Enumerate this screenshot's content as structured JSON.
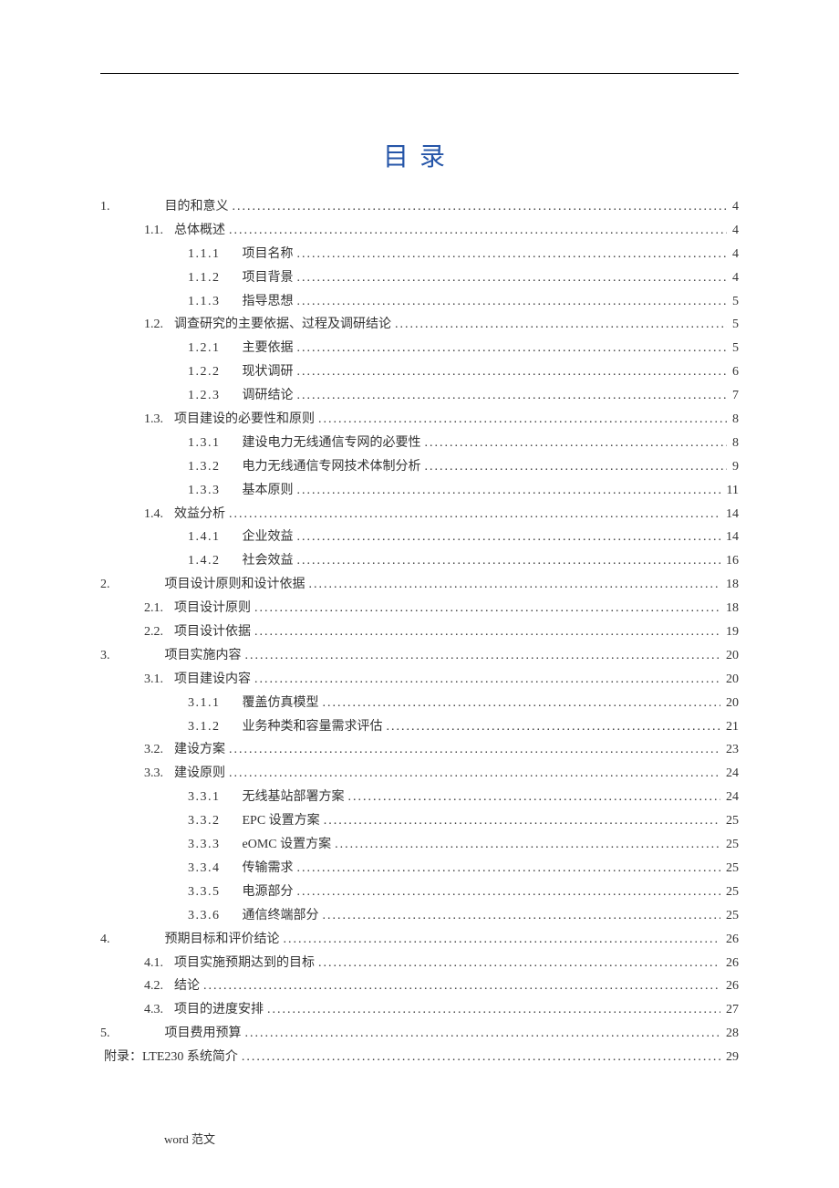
{
  "title": "目录",
  "footer": "word 范文",
  "toc": [
    {
      "level": 0,
      "num": "1.",
      "text": "目的和意义",
      "page": "4",
      "gap": 56
    },
    {
      "level": 1,
      "num": "1.1.",
      "text": "总体概述",
      "page": "4"
    },
    {
      "level": 2,
      "num": "1.1.1",
      "text": "项目名称",
      "page": "4"
    },
    {
      "level": 2,
      "num": "1.1.2",
      "text": "项目背景",
      "page": "4"
    },
    {
      "level": 2,
      "num": "1.1.3",
      "text": "指导思想",
      "page": "5"
    },
    {
      "level": 1,
      "num": "1.2.",
      "text": "调查研究的主要依据、过程及调研结论",
      "page": "5"
    },
    {
      "level": 2,
      "num": "1.2.1",
      "text": "主要依据",
      "page": "5"
    },
    {
      "level": 2,
      "num": "1.2.2",
      "text": "现状调研",
      "page": "6"
    },
    {
      "level": 2,
      "num": "1.2.3",
      "text": "调研结论",
      "page": "7"
    },
    {
      "level": 1,
      "num": "1.3.",
      "text": "项目建设的必要性和原则",
      "page": "8"
    },
    {
      "level": 2,
      "num": "1.3.1",
      "text": "建设电力无线通信专网的必要性",
      "page": "8"
    },
    {
      "level": 2,
      "num": "1.3.2",
      "text": "电力无线通信专网技术体制分析",
      "page": "9"
    },
    {
      "level": 2,
      "num": "1.3.3",
      "text": "基本原则",
      "page": "11"
    },
    {
      "level": 1,
      "num": "1.4.",
      "text": "效益分析",
      "page": "14"
    },
    {
      "level": 2,
      "num": "1.4.1",
      "text": "企业效益",
      "page": "14"
    },
    {
      "level": 2,
      "num": "1.4.2",
      "text": "社会效益",
      "page": "16"
    },
    {
      "level": 0,
      "num": "2.",
      "text": "项目设计原则和设计依据",
      "page": "18",
      "gap": 56
    },
    {
      "level": 1,
      "num": "2.1.",
      "text": "项目设计原则",
      "page": "18"
    },
    {
      "level": 1,
      "num": "2.2.",
      "text": "项目设计依据",
      "page": "19"
    },
    {
      "level": 0,
      "num": "3.",
      "text": "项目实施内容",
      "page": "20",
      "gap": 56
    },
    {
      "level": 1,
      "num": "3.1.",
      "text": "项目建设内容",
      "page": "20"
    },
    {
      "level": 2,
      "num": "3.1.1",
      "text": "覆盖仿真模型",
      "page": "20"
    },
    {
      "level": 2,
      "num": "3.1.2",
      "text": "业务种类和容量需求评估",
      "page": "21"
    },
    {
      "level": 1,
      "num": "3.2.",
      "text": "建设方案",
      "page": "23"
    },
    {
      "level": 1,
      "num": "3.3.",
      "text": "建设原则",
      "page": "24"
    },
    {
      "level": 2,
      "num": "3.3.1",
      "text": "无线基站部署方案",
      "page": "24"
    },
    {
      "level": 2,
      "num": "3.3.2",
      "text": "EPC 设置方案",
      "page": "25"
    },
    {
      "level": 2,
      "num": "3.3.3",
      "text": "eOMC 设置方案",
      "page": "25"
    },
    {
      "level": 2,
      "num": "3.3.4",
      "text": "传输需求",
      "page": "25"
    },
    {
      "level": 2,
      "num": "3.3.5",
      "text": "电源部分",
      "page": "25"
    },
    {
      "level": 2,
      "num": "3.3.6",
      "text": "通信终端部分",
      "page": "25"
    },
    {
      "level": 0,
      "num": "4.",
      "text": "预期目标和评价结论",
      "page": "26",
      "gap": 56
    },
    {
      "level": 1,
      "num": "4.1.",
      "text": "项目实施预期达到的目标",
      "page": "26"
    },
    {
      "level": 1,
      "num": "4.2.",
      "text": "结论",
      "page": "26"
    },
    {
      "level": 1,
      "num": "4.3.",
      "text": "项目的进度安排",
      "page": "27"
    },
    {
      "level": 0,
      "num": "5.",
      "text": "项目费用预算",
      "page": "28",
      "gap": 56
    },
    {
      "level": 0,
      "num": "",
      "text": "附录：LTE230 系统简介",
      "page": "29",
      "full": true
    }
  ]
}
